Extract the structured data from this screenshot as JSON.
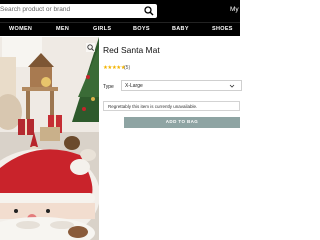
{
  "header": {
    "search_placeholder": "Search product or brand",
    "account_label": "My"
  },
  "nav": {
    "items": [
      "WOMEN",
      "MEN",
      "GIRLS",
      "BOYS",
      "BABY",
      "SHOES"
    ]
  },
  "product": {
    "title": "Red Santa Mat",
    "rating_stars": "★★★★★",
    "rating_value": 5,
    "review_count": "(5)",
    "type_label": "Type",
    "type_value": "X-Large",
    "unavailable_notice": "Regrettably this item is currently unavailable.",
    "add_button": "ADD TO BAG",
    "button_color": "#8ea4a3"
  },
  "icons": [
    "search-icon",
    "zoom-icon",
    "chevron-down-icon"
  ]
}
